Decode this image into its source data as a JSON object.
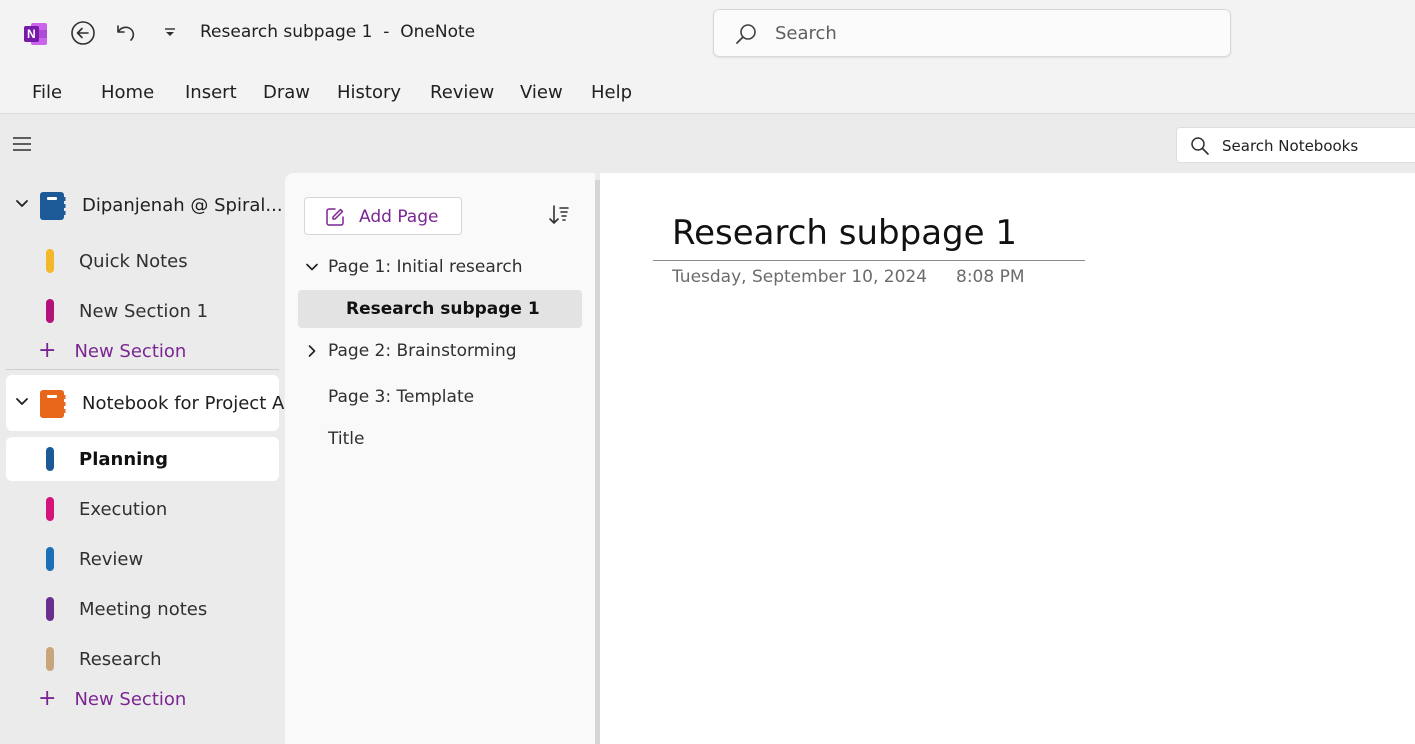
{
  "window": {
    "title": "Research subpage 1  -  OneNote",
    "search_placeholder": "Search"
  },
  "menu": {
    "items": [
      "File",
      "Home",
      "Insert",
      "Draw",
      "History",
      "Review",
      "View",
      "Help"
    ]
  },
  "toolbar": {
    "search_notebooks": "Search Notebooks"
  },
  "notebooks": [
    {
      "name": "Dipanjenah @ Spiral...",
      "icon_color": "#1b5a96",
      "sections": [
        {
          "name": "Quick Notes",
          "color": "#f2b82a"
        },
        {
          "name": "New Section 1",
          "color": "#b4127a"
        }
      ],
      "new_section_label": "New Section"
    },
    {
      "name": "Notebook for Project A",
      "icon_color": "#e8661a",
      "sections": [
        {
          "name": "Planning",
          "color": "#1b5a96",
          "selected": true
        },
        {
          "name": "Execution",
          "color": "#d4147b"
        },
        {
          "name": "Review",
          "color": "#1a6fb8"
        },
        {
          "name": "Meeting notes",
          "color": "#6a2f8e"
        },
        {
          "name": "Research",
          "color": "#c9a57b"
        }
      ],
      "new_section_label": "New Section"
    }
  ],
  "pages": {
    "add_page_label": "Add Page",
    "items": [
      {
        "title": "Page 1: Initial research",
        "expanded": true
      },
      {
        "title": "Research subpage 1",
        "subpage": true,
        "active": true
      },
      {
        "title": "Page 2: Brainstorming",
        "expanded": false
      },
      {
        "title": "Page 3: Template"
      },
      {
        "title": "Title"
      }
    ]
  },
  "canvas": {
    "title": "Research subpage 1",
    "date": "Tuesday, September 10, 2024",
    "time": "8:08 PM"
  },
  "colors": {
    "accent": "#7b2592"
  }
}
